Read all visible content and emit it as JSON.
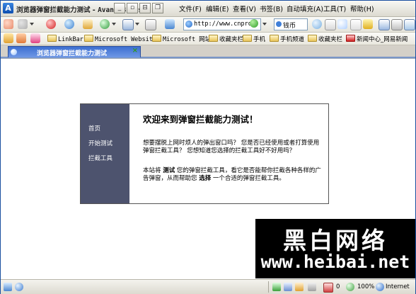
{
  "window": {
    "title": "浏览器弹窗拦截能力测试 - ",
    "title_app": "Avant Browser",
    "app_logo": "A"
  },
  "menu": [
    "文件(F)",
    "编辑(E)",
    "查看(V)",
    "书签(B)",
    "自动填充(A)",
    "工具(T)",
    "帮助(H)"
  ],
  "toolbar": {
    "address": "http://www.cnproxy",
    "search_label": "钱币"
  },
  "favorites": [
    {
      "label": "LinkBar",
      "mono": true
    },
    {
      "label": "Microsoft Websites",
      "mono": true
    },
    {
      "label": "Microsoft 网站",
      "mono": true
    },
    {
      "label": "收藏夹栏",
      "mono": false
    },
    {
      "label": "手机",
      "mono": false
    },
    {
      "label": "手机频道",
      "mono": false
    },
    {
      "label": "收藏夹栏",
      "mono": false
    },
    {
      "label": "新闻中心_网易新闻",
      "mono": false
    }
  ],
  "tab": {
    "label": "浏览器弹窗拦截能力测试",
    "close": "×"
  },
  "page": {
    "title": "欢迎来到弹窗拦截能力测试！",
    "nav": [
      "首页",
      "开始测试",
      "拦截工具"
    ],
    "para1": "想要摆脱上网时烦人的弹出窗口吗？ 您是否已经使用或者打算使用弹窗拦截工具？ 您想知道您选择的拦截工具好不好用吗？",
    "para2_a": "本站将 ",
    "para2_b": "测试",
    "para2_c": " 您的弹窗拦截工具，看它是否能帮你拦截各种各样的广告弹窗，从而帮助您 ",
    "para2_d": "选择",
    "para2_e": " 一个合适的弹窗拦截工具。"
  },
  "watermark": {
    "cn": "黑白网络",
    "en": "www.heibai.net"
  },
  "status": {
    "popup_count": "0",
    "zoom": "100%",
    "zone": "Internet"
  }
}
